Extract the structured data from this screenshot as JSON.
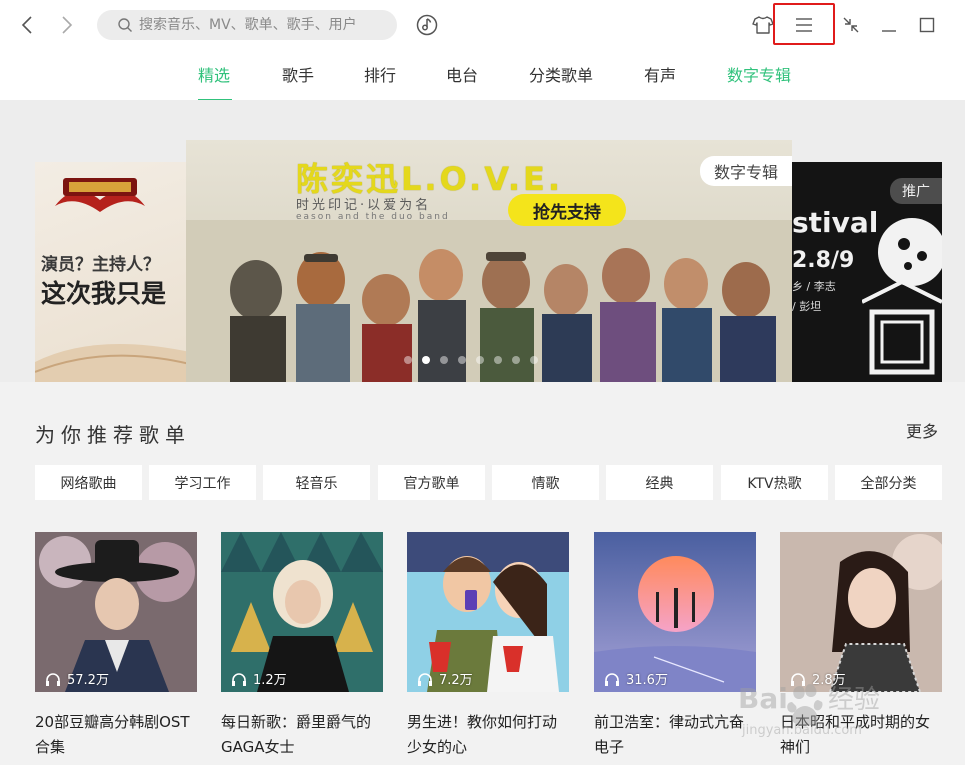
{
  "search": {
    "placeholder": "搜索音乐、MV、歌单、歌手、用户"
  },
  "tabs": [
    {
      "label": "精选"
    },
    {
      "label": "歌手"
    },
    {
      "label": "排行"
    },
    {
      "label": "电台"
    },
    {
      "label": "分类歌单"
    },
    {
      "label": "有声"
    },
    {
      "label": "数字专辑"
    }
  ],
  "banner": {
    "left": {
      "line1": "演员？主持人？",
      "line2": "这次我只是"
    },
    "main": {
      "title": "陈奕迅L.O.V.E.",
      "subtitle": "时光印记·以爱为名",
      "subtitle2": "eason and the duo band",
      "cta": "抢先支持",
      "tag": "数字专辑"
    },
    "right": {
      "tag": "推广",
      "headline": "stival",
      "date": "2.8/9",
      "names1": "乡 / 李志",
      "names2": "/ 彭坦"
    },
    "dots": 8,
    "active_dot": 1
  },
  "section": {
    "title": "为你推荐歌单",
    "more": "更多"
  },
  "filters": [
    "网络歌曲",
    "学习工作",
    "轻音乐",
    "官方歌单",
    "情歌",
    "经典",
    "KTV热歌",
    "全部分类"
  ],
  "playlists": [
    {
      "name": "20部豆瓣高分韩剧OST合集",
      "plays": "57.2万"
    },
    {
      "name": "每日新歌：爵里爵气的GAGA女士",
      "plays": "1.2万"
    },
    {
      "name": "男生进！教你如何打动少女的心",
      "plays": "7.2万"
    },
    {
      "name": "前卫浩室：律动式亢奋电子",
      "plays": "31.6万"
    },
    {
      "name": "日本昭和平成时期的女神们",
      "plays": "2.8万"
    }
  ],
  "watermark": {
    "text1": "Bai",
    "text2": "经验",
    "url": "jingyan.baidu.com"
  },
  "colors": {
    "accent": "#31c27c",
    "highlight": "#e01b1b"
  }
}
